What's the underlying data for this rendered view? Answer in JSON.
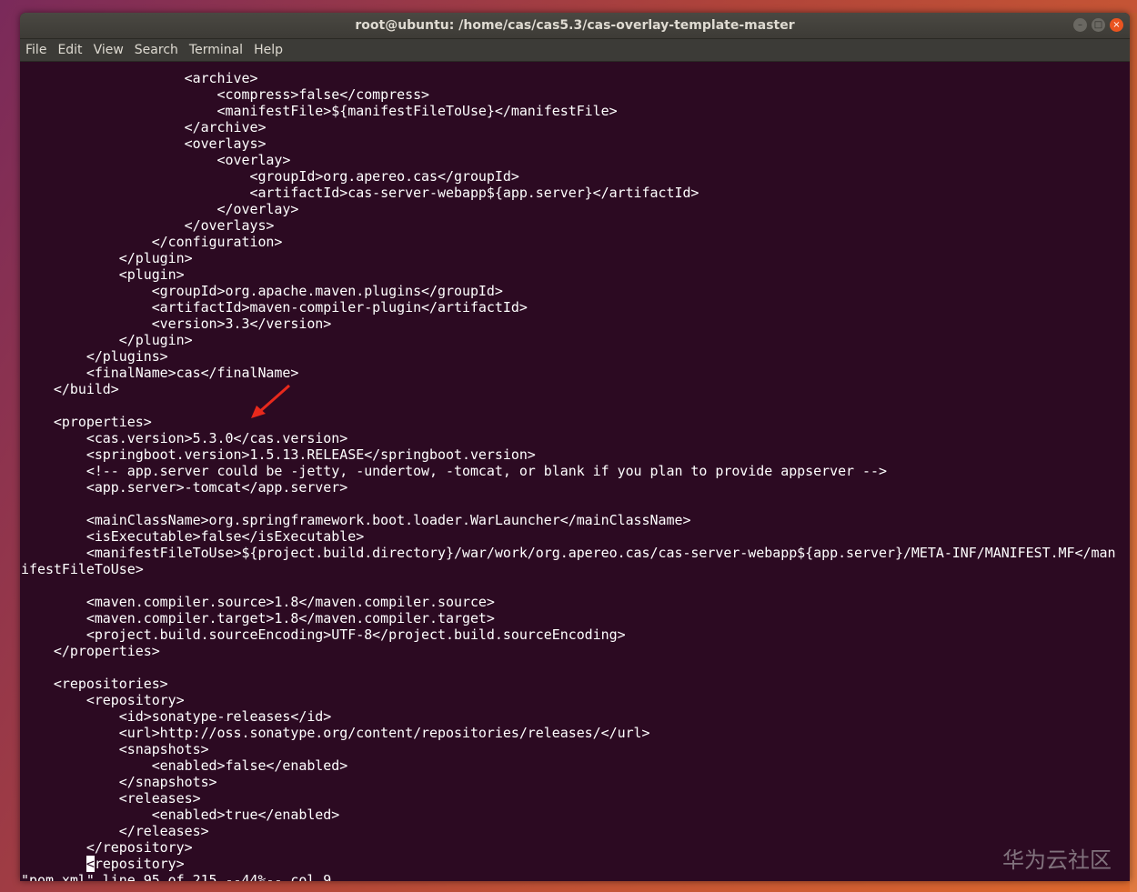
{
  "window": {
    "title": "root@ubuntu: /home/cas/cas5.3/cas-overlay-template-master",
    "buttons": {
      "minimize": "–",
      "maximize": "□",
      "close": "×"
    }
  },
  "menu": [
    "File",
    "Edit",
    "View",
    "Search",
    "Terminal",
    "Help"
  ],
  "terminal": {
    "lines": [
      "                    <archive>",
      "                        <compress>false</compress>",
      "                        <manifestFile>${manifestFileToUse}</manifestFile>",
      "                    </archive>",
      "                    <overlays>",
      "                        <overlay>",
      "                            <groupId>org.apereo.cas</groupId>",
      "                            <artifactId>cas-server-webapp${app.server}</artifactId>",
      "                        </overlay>",
      "                    </overlays>",
      "                </configuration>",
      "            </plugin>",
      "            <plugin>",
      "                <groupId>org.apache.maven.plugins</groupId>",
      "                <artifactId>maven-compiler-plugin</artifactId>",
      "                <version>3.3</version>",
      "            </plugin>",
      "        </plugins>",
      "        <finalName>cas</finalName>",
      "    </build>",
      "",
      "    <properties>",
      "        <cas.version>5.3.0</cas.version>",
      "        <springboot.version>1.5.13.RELEASE</springboot.version>",
      "        <!-- app.server could be -jetty, -undertow, -tomcat, or blank if you plan to provide appserver -->",
      "        <app.server>-tomcat</app.server>",
      "",
      "        <mainClassName>org.springframework.boot.loader.WarLauncher</mainClassName>",
      "        <isExecutable>false</isExecutable>",
      "        <manifestFileToUse>${project.build.directory}/war/work/org.apereo.cas/cas-server-webapp${app.server}/META-INF/MANIFEST.MF</man",
      "ifestFileToUse>",
      "",
      "        <maven.compiler.source>1.8</maven.compiler.source>",
      "        <maven.compiler.target>1.8</maven.compiler.target>",
      "        <project.build.sourceEncoding>UTF-8</project.build.sourceEncoding>",
      "    </properties>",
      "",
      "    <repositories>",
      "        <repository>",
      "            <id>sonatype-releases</id>",
      "            <url>http://oss.sonatype.org/content/repositories/releases/</url>",
      "            <snapshots>",
      "                <enabled>false</enabled>",
      "            </snapshots>",
      "            <releases>",
      "                <enabled>true</enabled>",
      "            </releases>",
      "        </repository>"
    ],
    "cursor_line": {
      "indent": "        ",
      "cursor_char": "<",
      "rest": "repository>"
    },
    "status": "\"pom.xml\" line 95 of 215 --44%-- col 9"
  },
  "watermark": "华为云社区",
  "colors": {
    "terminal_bg": "#2c0a22",
    "text": "#ffffff",
    "arrow": "#e8291c",
    "titlebar": "#3d3b36"
  }
}
